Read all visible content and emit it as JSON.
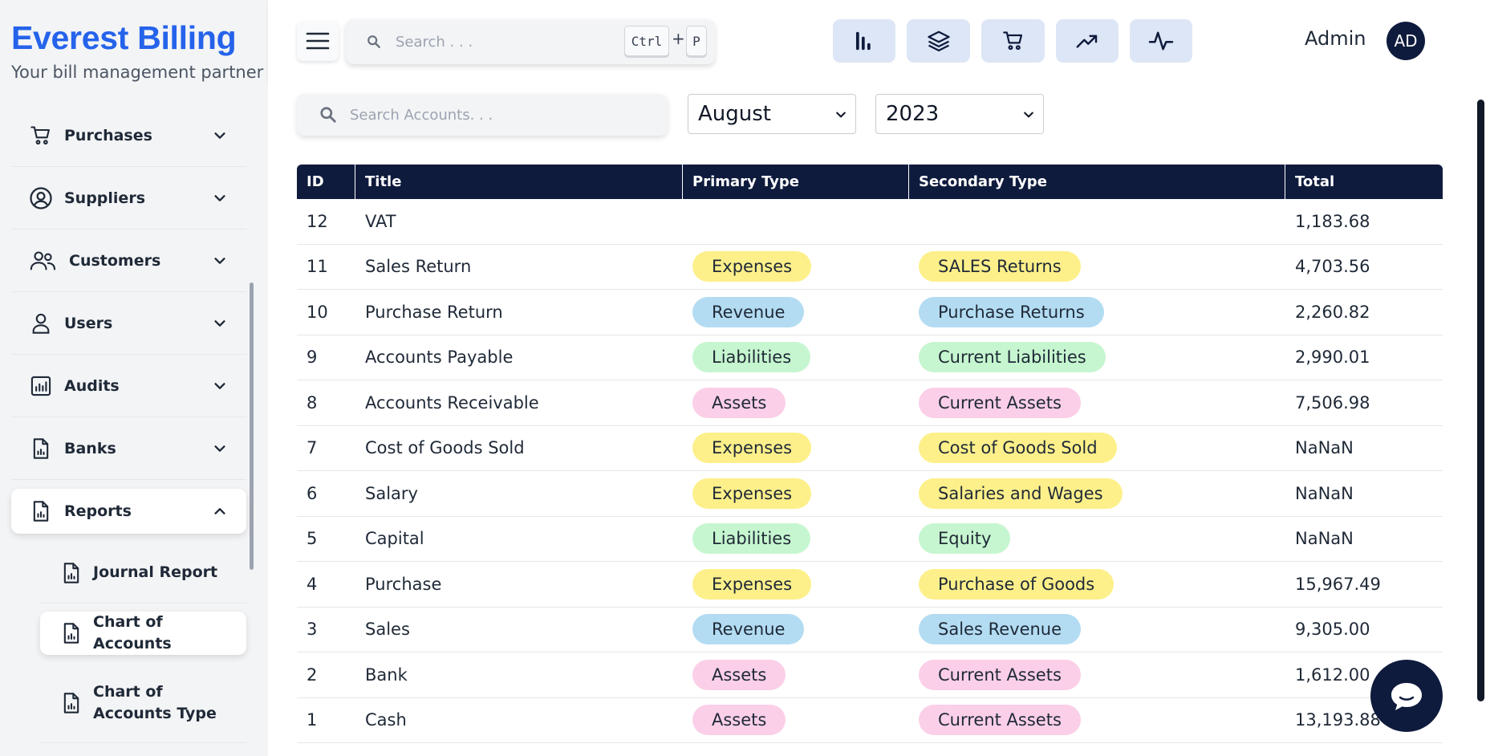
{
  "brand": {
    "title": "Everest Billing",
    "tagline": "Your bill management partner"
  },
  "colors": {
    "brand": "#2563eb",
    "navy": "#0f1b3d",
    "expenses": "#fdf08a",
    "revenue": "#b3dcf2",
    "liabilities": "#c6f6cf",
    "assets": "#fbcfe8"
  },
  "sidebar": {
    "items": [
      {
        "label": "Purchases",
        "icon": "cart-icon"
      },
      {
        "label": "Suppliers",
        "icon": "user-circle-icon"
      },
      {
        "label": "Customers",
        "icon": "users-icon"
      },
      {
        "label": "Users",
        "icon": "user-icon"
      },
      {
        "label": "Audits",
        "icon": "bar-chart-icon"
      },
      {
        "label": "Banks",
        "icon": "report-file-icon"
      },
      {
        "label": "Reports",
        "icon": "report-file-icon",
        "expanded": true
      }
    ],
    "sub_items": [
      {
        "label": "Journal Report"
      },
      {
        "label": "Chart of Accounts",
        "active": true
      },
      {
        "label": "Chart of Accounts Type"
      }
    ]
  },
  "header": {
    "search_placeholder": "Search . . .",
    "shortcut_ctrl": "Ctrl",
    "shortcut_plus": "+",
    "shortcut_key": "P",
    "icons": [
      "bar-chart-icon",
      "layers-icon",
      "cart-icon",
      "trending-up-icon",
      "activity-icon"
    ],
    "user_name": "Admin",
    "avatar_initials": "AD"
  },
  "filters": {
    "search_placeholder": "Search Accounts. . .",
    "month": "August",
    "year": "2023"
  },
  "table": {
    "headers": {
      "id": "ID",
      "title": "Title",
      "primary": "Primary Type",
      "secondary": "Secondary Type",
      "total": "Total"
    },
    "rows": [
      {
        "id": "12",
        "title": "VAT",
        "primary": "",
        "secondary": "",
        "total": "1,183.68",
        "tone": ""
      },
      {
        "id": "11",
        "title": "Sales Return",
        "primary": "Expenses",
        "secondary": "SALES Returns",
        "total": "4,703.56",
        "tone": "expenses"
      },
      {
        "id": "10",
        "title": "Purchase Return",
        "primary": "Revenue",
        "secondary": "Purchase Returns",
        "total": "2,260.82",
        "tone": "revenue"
      },
      {
        "id": "9",
        "title": "Accounts Payable",
        "primary": "Liabilities",
        "secondary": "Current Liabilities",
        "total": "2,990.01",
        "tone": "liabilities"
      },
      {
        "id": "8",
        "title": "Accounts Receivable",
        "primary": "Assets",
        "secondary": "Current Assets",
        "total": "7,506.98",
        "tone": "assets"
      },
      {
        "id": "7",
        "title": "Cost of Goods Sold",
        "primary": "Expenses",
        "secondary": "Cost of Goods Sold",
        "total": "NaNaN",
        "tone": "expenses"
      },
      {
        "id": "6",
        "title": "Salary",
        "primary": "Expenses",
        "secondary": "Salaries and Wages",
        "total": "NaNaN",
        "tone": "expenses"
      },
      {
        "id": "5",
        "title": "Capital",
        "primary": "Liabilities",
        "secondary": "Equity",
        "total": "NaNaN",
        "tone": "liabilities"
      },
      {
        "id": "4",
        "title": "Purchase",
        "primary": "Expenses",
        "secondary": "Purchase of Goods",
        "total": "15,967.49",
        "tone": "expenses"
      },
      {
        "id": "3",
        "title": "Sales",
        "primary": "Revenue",
        "secondary": "Sales Revenue",
        "total": "9,305.00",
        "tone": "revenue"
      },
      {
        "id": "2",
        "title": "Bank",
        "primary": "Assets",
        "secondary": "Current Assets",
        "total": "1,612.00",
        "tone": "assets"
      },
      {
        "id": "1",
        "title": "Cash",
        "primary": "Assets",
        "secondary": "Current Assets",
        "total": "13,193.88",
        "tone": "assets"
      }
    ]
  }
}
